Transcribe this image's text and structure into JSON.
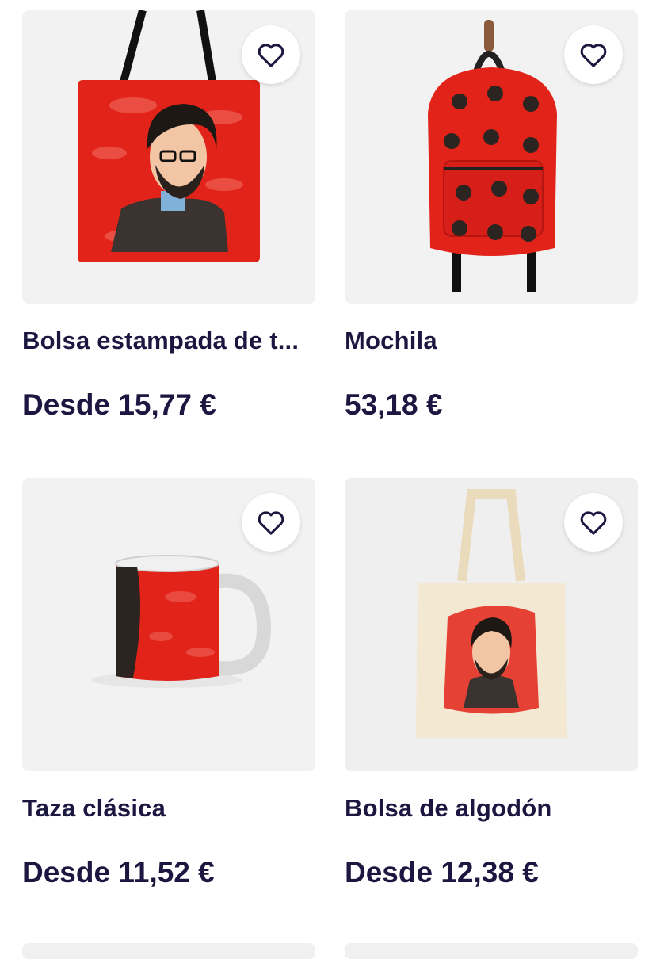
{
  "products": [
    {
      "title": "Bolsa estampada de t...",
      "price": "Desde 15,77 €"
    },
    {
      "title": "Mochila",
      "price": "53,18 €"
    },
    {
      "title": "Taza clásica",
      "price": "Desde 11,52 €"
    },
    {
      "title": "Bolsa de algodón",
      "price": "Desde 12,38 €"
    }
  ],
  "icons": {
    "favorite": "heart-outline-icon"
  },
  "colors": {
    "text": "#1b1740",
    "red": "#e2231a",
    "card_bg": "#f2f2f2",
    "cotton": "#f3e8d2"
  }
}
